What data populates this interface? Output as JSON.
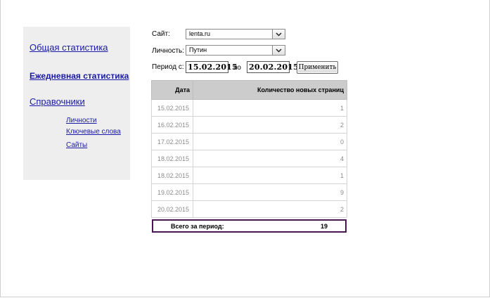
{
  "sidebar": {
    "main_items": [
      {
        "label": "Общая статистика"
      },
      {
        "label": "Ежедневная статистика"
      },
      {
        "label": "Справочники"
      }
    ],
    "sub_items": [
      {
        "label": "Личности"
      },
      {
        "label": "Ключевые слова"
      },
      {
        "label": "Сайты"
      }
    ]
  },
  "filters": {
    "site_label": "Сайт:",
    "site_value": "lenta.ru",
    "person_label": "Личность:",
    "person_value": "Путин",
    "period_label": "Период с:",
    "date_from": "15.02.2015",
    "to_label": "по",
    "date_to": "20.02.2015",
    "apply_label": "Применить"
  },
  "table": {
    "headers": [
      "Дата",
      "Количество новых страниц"
    ],
    "rows": [
      {
        "date": "15.02.2015",
        "count": "1"
      },
      {
        "date": "16.02.2015",
        "count": "2"
      },
      {
        "date": "17.02.2015",
        "count": "0"
      },
      {
        "date": "18.02.2015",
        "count": "4"
      },
      {
        "date": "18.02.2015",
        "count": "1"
      },
      {
        "date": "19.02.2015",
        "count": "9"
      },
      {
        "date": "20.02.2015",
        "count": "2"
      }
    ],
    "total_label": "Всего за период:",
    "total_value": "19"
  },
  "colors": {
    "link": "#1a1aa6",
    "sidebar_bg": "#eeeeee",
    "header_bg": "#cccccc",
    "total_border": "#4a1850"
  },
  "icons": {
    "dropdown": "chevron-down-icon"
  }
}
